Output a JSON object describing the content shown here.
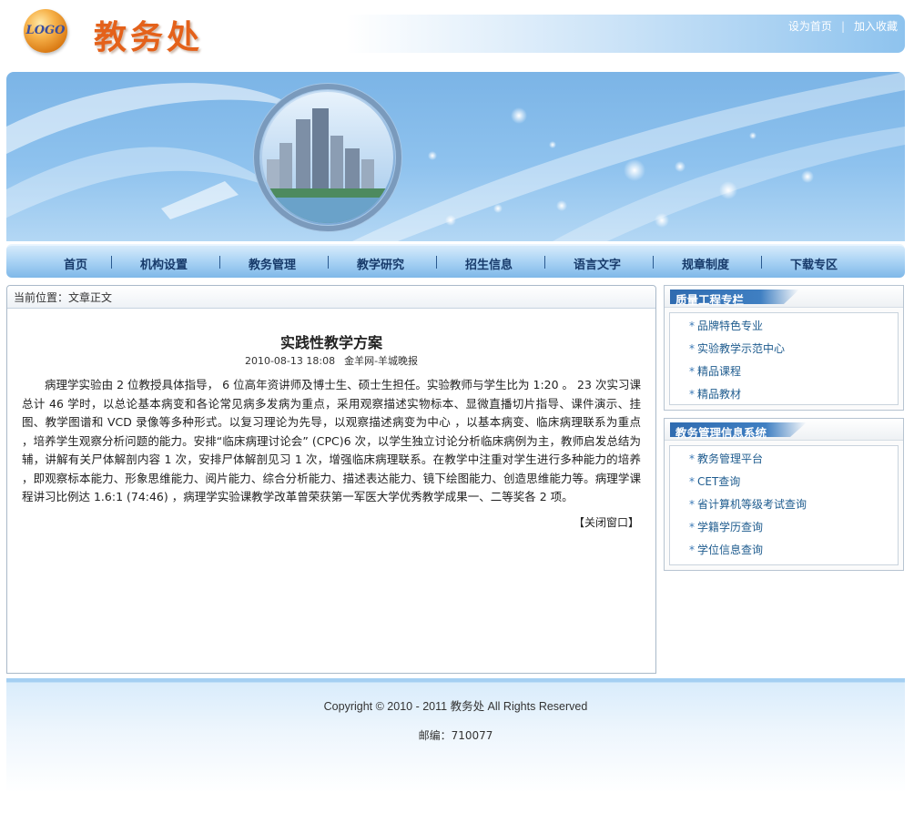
{
  "header": {
    "logo_text": "LOGO",
    "site_title": "教务处",
    "links": {
      "set_home": "设为首页",
      "separator": "|",
      "add_favorite": "加入收藏"
    }
  },
  "nav": {
    "items": [
      "首页",
      "机构设置",
      "教务管理",
      "教学研究",
      "招生信息",
      "语言文字",
      "规章制度",
      "下载专区"
    ],
    "separator": "|"
  },
  "breadcrumb": "当前位置：文章正文",
  "article": {
    "title": "实践性教学方案",
    "date": "2010-08-13 18:08",
    "source": "金羊网-羊城晚报",
    "body": "病理学实验由 2 位教授具体指导， 6 位高年资讲师及博士生、硕士生担任。实验教师与学生比为 1:20 。 23 次实习课总计 46 学时，以总论基本病变和各论常见病多发病为重点，采用观察描述实物标本、显微直播切片指导、课件演示、挂图、教学图谱和 VCD 录像等多种形式。以复习理论为先导，以观察描述病变为中心 ，以基本病变、临床病理联系为重点 ，培养学生观察分析问题的能力。安排“临床病理讨论会” (CPC)6 次，以学生独立讨论分析临床病例为主，教师启发总结为辅，讲解有关尸体解剖内容 1 次，安排尸体解剖见习 1 次，增强临床病理联系。在教学中注重对学生进行多种能力的培养 ，即观察标本能力、形象思维能力、阅片能力、综合分析能力、描述表达能力、镜下绘图能力、创造思维能力等。病理学课程讲习比例达 1.6:1 (74:46) ，病理学实验课教学改革曾荣获第一军医大学优秀教学成果一、二等奖各 2 项。",
    "close_label": "【关闭窗口】"
  },
  "sidebar": {
    "sections": [
      {
        "title": "质量工程专栏",
        "items": [
          "品牌特色专业",
          "实验教学示范中心",
          "精品课程",
          "精品教材"
        ]
      },
      {
        "title": "教务管理信息系统",
        "items": [
          "教务管理平台",
          "CET查询",
          "省计算机等级考试查询",
          "学籍学历查询",
          "学位信息查询"
        ]
      }
    ],
    "bullet": "*"
  },
  "footer": {
    "copyright": "Copyright © 2010 - 2011 教务处  All Rights Reserved",
    "postcode": "邮编：710077"
  },
  "colors": {
    "title_orange": "#e4611a",
    "nav_text": "#173a6a",
    "link_blue": "#1f5c8f",
    "banner_blue": "#8ec2ee"
  }
}
